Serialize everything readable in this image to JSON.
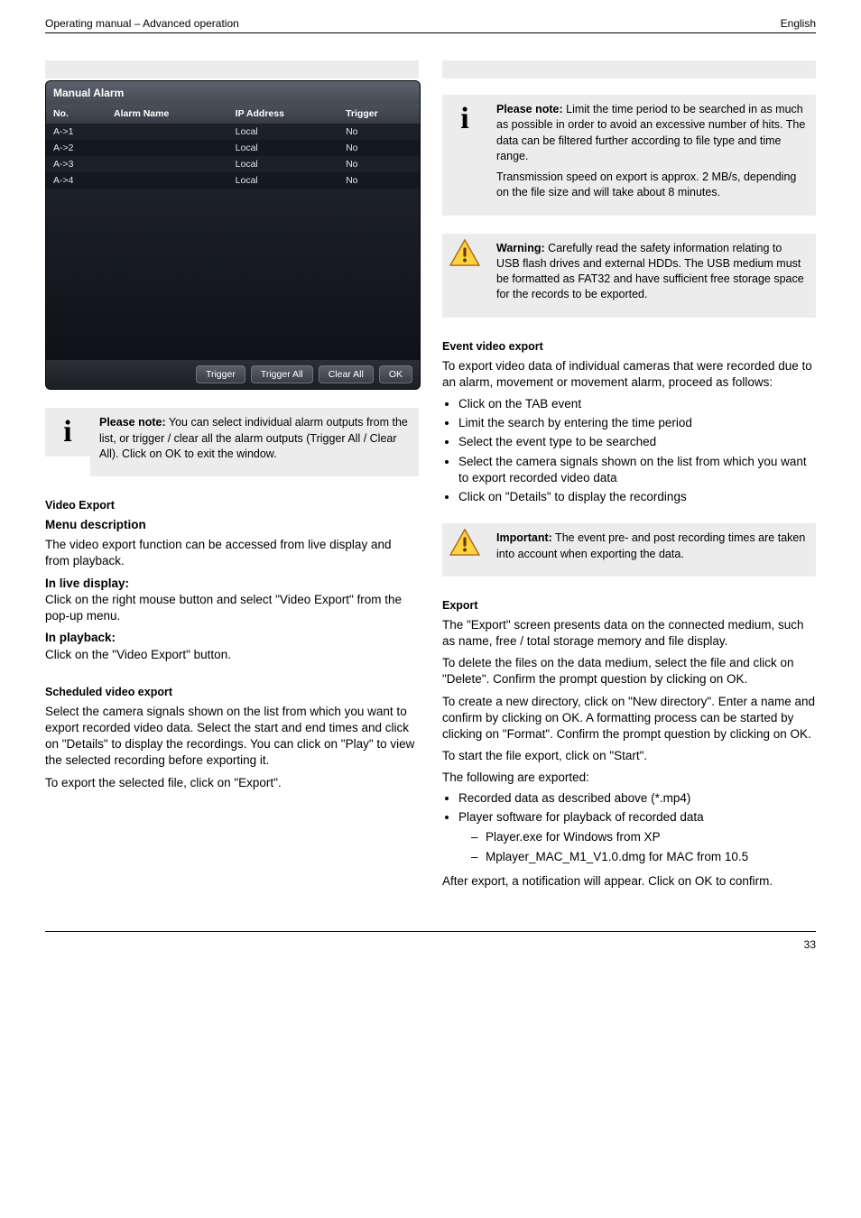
{
  "header": {
    "left": "Operating manual – Advanced operation",
    "right": "English"
  },
  "col1": {
    "screenshot": {
      "title": "Manual Alarm",
      "columns": [
        "No.",
        "Alarm Name",
        "IP Address",
        "Trigger"
      ],
      "rows": [
        {
          "no": "A->1",
          "name": "",
          "ip": "Local",
          "trigger": "No"
        },
        {
          "no": "A->2",
          "name": "",
          "ip": "Local",
          "trigger": "No"
        },
        {
          "no": "A->3",
          "name": "",
          "ip": "Local",
          "trigger": "No"
        },
        {
          "no": "A->4",
          "name": "",
          "ip": "Local",
          "trigger": "No"
        }
      ],
      "buttons": {
        "trigger": "Trigger",
        "trigger_all": "Trigger All",
        "clear_all": "Clear All",
        "ok": "OK"
      }
    },
    "caption_bold": "Please note:",
    "info_note": " You can select individual alarm outputs from the list, or trigger / clear all the alarm outputs (Trigger All / Clear All). Click on OK to exit the window.",
    "sec_title": "Video Export",
    "sec_subtitle": "Menu description",
    "para1": "The video export function can be accessed from live display and from playback.",
    "para2_lead": "In live display:",
    "para2_body": "Click on the right mouse button and select \"Video Export\" from the pop-up menu.",
    "para3_lead": "In playback:",
    "para3_body": "Click on the \"Video Export\" button.",
    "sec2_title": "Scheduled video export",
    "sec2_p1": "Select the camera signals shown on the list from which you want to export recorded video data. Select the start and end times and click on \"Details\" to display the recordings. You can click on \"Play\" to view the selected recording before exporting it.",
    "sec2_p2": "To export the selected file, click on \"Export\"."
  },
  "col2": {
    "note1_bold": "Please note:",
    "note1_p1": " Limit the time period to be searched in as much as possible in order to avoid an excessive number of hits. The data can be filtered further according to file type and time range.",
    "note1_p2": "Transmission speed on export is approx. 2 MB/s, depending on the file size and will take about 8 minutes.",
    "warn1_bold": "Warning:",
    "warn1_body": " Carefully read the safety information relating to USB flash drives and external HDDs. The USB medium must be formatted as FAT32 and have sufficient free storage space for the records to be exported.",
    "sec3_title": "Event video export",
    "sec3_p1": "To export video data of individual cameras that were recorded due to an alarm, movement or movement alarm, proceed as follows:",
    "sec3_li1": "Click on the TAB event",
    "sec3_li2": "Limit the search by entering the time period",
    "sec3_li3": "Select the event type to be searched",
    "sec3_li4": "Select the camera signals shown on the list from which you want to export recorded video data",
    "sec3_li5": "Click on \"Details\" to display the recordings",
    "warn2_bold": "Important:",
    "warn2_body": " The event pre- and post recording times are taken into account when exporting the data.",
    "sec4_title": "Export",
    "sec4_p1": "The \"Export\" screen presents data on the connected medium, such as name, free / total storage memory and file display.",
    "sec4_p2": "To delete the files on the data medium, select the file and click on \"Delete\". Confirm the prompt question by clicking on OK.",
    "sec4_p3": "To create a new directory, click on \"New directory\". Enter a name and confirm by clicking on OK. A formatting process can be started by clicking on \"Format\". Confirm the prompt question by clicking on OK.",
    "sec4_p4": "To start the file export, click on \"Start\".",
    "bullet_lead": "The following are exported:",
    "bullets": [
      "Recorded data as described above (*.mp4)",
      "Player software for playback of recorded data"
    ],
    "sub_li1": "Player.exe for Windows from XP",
    "sub_li2": "Mplayer_MAC_M1_V1.0.dmg for MAC from 10.5",
    "after_p": "After export, a notification will appear. Click on OK to confirm."
  },
  "footer": {
    "page": "33"
  }
}
